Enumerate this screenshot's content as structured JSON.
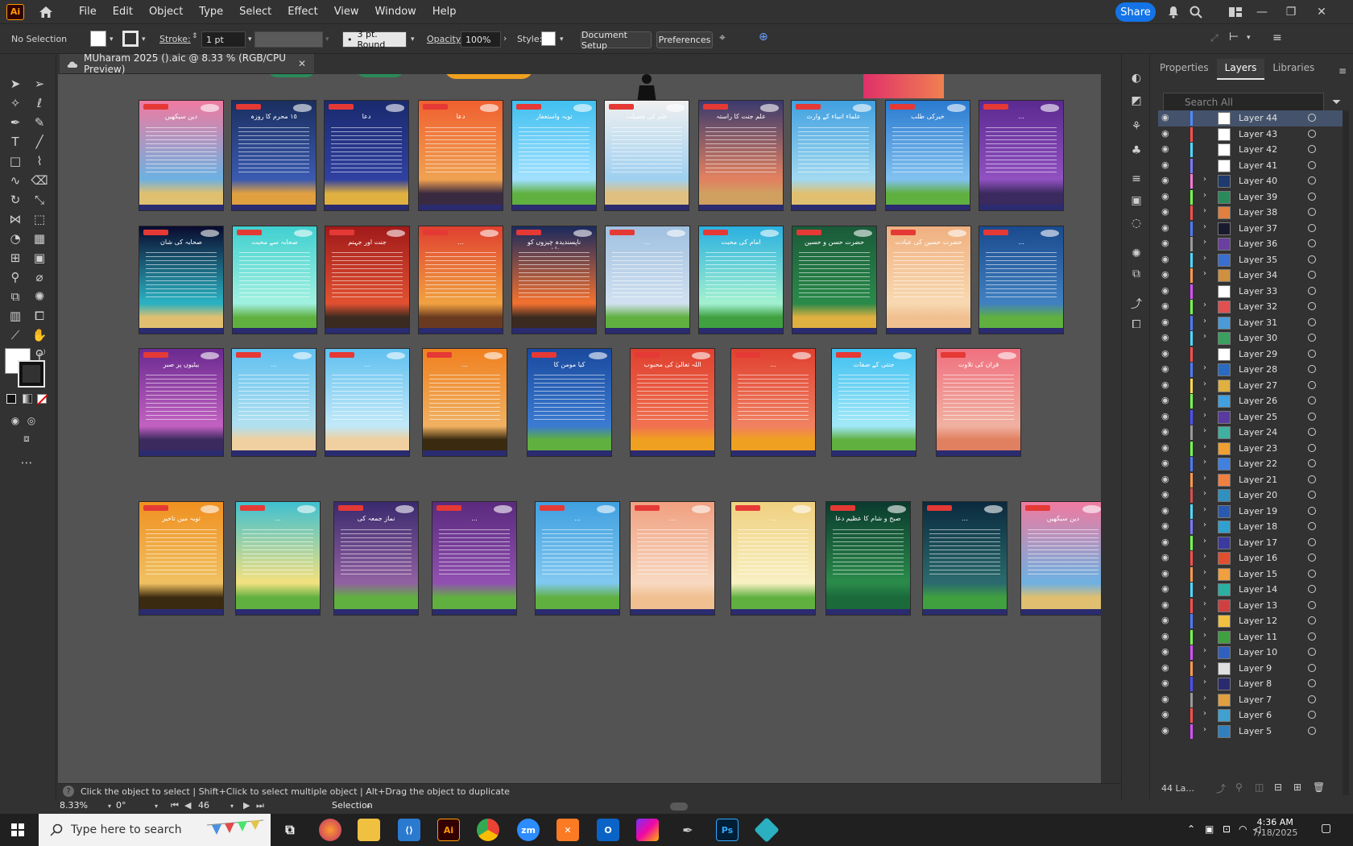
{
  "menubar": {
    "app_logo": "Ai",
    "items": [
      "File",
      "Edit",
      "Object",
      "Type",
      "Select",
      "Effect",
      "View",
      "Window",
      "Help"
    ],
    "share_label": "Share"
  },
  "controlbar": {
    "selection": "No Selection",
    "stroke_label": "Stroke:",
    "stroke_value": "1 pt",
    "brush_value": "3 pt. Round",
    "opacity_label": "Opacity:",
    "opacity_value": "100%",
    "style_label": "Style:",
    "document_setup": "Document Setup",
    "preferences": "Preferences"
  },
  "document": {
    "tab_title": "MUharam 2025 ().aic @ 8.33 % (RGB/CPU Preview)"
  },
  "panel": {
    "tabs": [
      "Properties",
      "Layers",
      "Libraries"
    ],
    "active_tab": "Layers",
    "search_placeholder": "Search All",
    "layers": [
      {
        "name": "Layer 44",
        "color": "#4f8bff",
        "thumb": "#ffffff"
      },
      {
        "name": "Layer 43",
        "color": "#ff4f4f",
        "thumb": "#ffffff"
      },
      {
        "name": "Layer 42",
        "color": "#4fd9ff",
        "thumb": "#ffffff"
      },
      {
        "name": "Layer 41",
        "color": "#7a7aff",
        "thumb": "#ffffff"
      },
      {
        "name": "Layer 40",
        "color": "#ff7ad9",
        "thumb": "#1e3a6e"
      },
      {
        "name": "Layer 39",
        "color": "#7aff4f",
        "thumb": "#2b8a5b"
      },
      {
        "name": "Layer 38",
        "color": "#ff4f4f",
        "thumb": "#e08040"
      },
      {
        "name": "Layer 37",
        "color": "#4f7aff",
        "thumb": "#1a1a2e"
      },
      {
        "name": "Layer 36",
        "color": "#9a9a9a",
        "thumb": "#6a3fa0"
      },
      {
        "name": "Layer 35",
        "color": "#4fd9ff",
        "thumb": "#3a6ecf"
      },
      {
        "name": "Layer 34",
        "color": "#ff9a4f",
        "thumb": "#d09040"
      },
      {
        "name": "Layer 33",
        "color": "#d94fff",
        "thumb": "#ffffff"
      },
      {
        "name": "Layer 32",
        "color": "#7aff4f",
        "thumb": "#e05050"
      },
      {
        "name": "Layer 31",
        "color": "#4f7aff",
        "thumb": "#4a9ad9"
      },
      {
        "name": "Layer 30",
        "color": "#4fd9ff",
        "thumb": "#3aa060"
      },
      {
        "name": "Layer 29",
        "color": "#ff4f4f",
        "thumb": "#ffffff"
      },
      {
        "name": "Layer 28",
        "color": "#4f7aff",
        "thumb": "#2a6ac0"
      },
      {
        "name": "Layer 27",
        "color": "#ffd94f",
        "thumb": "#e0b040"
      },
      {
        "name": "Layer 26",
        "color": "#7aff4f",
        "thumb": "#40a0e0"
      },
      {
        "name": "Layer 25",
        "color": "#4f4fff",
        "thumb": "#5a3aa0"
      },
      {
        "name": "Layer 24",
        "color": "#9a9a9a",
        "thumb": "#40b0a0"
      },
      {
        "name": "Layer 23",
        "color": "#7aff4f",
        "thumb": "#f0a030"
      },
      {
        "name": "Layer 22",
        "color": "#4f7aff",
        "thumb": "#4080e0"
      },
      {
        "name": "Layer 21",
        "color": "#ff9a4f",
        "thumb": "#f08040"
      },
      {
        "name": "Layer 20",
        "color": "#d94f4f",
        "thumb": "#3090c0"
      },
      {
        "name": "Layer 19",
        "color": "#4fd9ff",
        "thumb": "#2a5ab0"
      },
      {
        "name": "Layer 18",
        "color": "#7a7aff",
        "thumb": "#30a0d0"
      },
      {
        "name": "Layer 17",
        "color": "#7aff4f",
        "thumb": "#3a3aa0"
      },
      {
        "name": "Layer 16",
        "color": "#ff4f4f",
        "thumb": "#e05030"
      },
      {
        "name": "Layer 15",
        "color": "#ff9a4f",
        "thumb": "#f0a040"
      },
      {
        "name": "Layer 14",
        "color": "#4fd9ff",
        "thumb": "#2ab0a0"
      },
      {
        "name": "Layer 13",
        "color": "#ff4f4f",
        "thumb": "#d04040"
      },
      {
        "name": "Layer 12",
        "color": "#4f7aff",
        "thumb": "#f0c040"
      },
      {
        "name": "Layer 11",
        "color": "#7aff4f",
        "thumb": "#40a040"
      },
      {
        "name": "Layer 10",
        "color": "#d94fff",
        "thumb": "#3060c0"
      },
      {
        "name": "Layer 9",
        "color": "#ff9a4f",
        "thumb": "#e0e0e0"
      },
      {
        "name": "Layer 8",
        "color": "#4f4fff",
        "thumb": "#2a2a6e"
      },
      {
        "name": "Layer 7",
        "color": "#9a9a9a",
        "thumb": "#e0a040"
      },
      {
        "name": "Layer 6",
        "color": "#ff4f4f",
        "thumb": "#40a0d0"
      },
      {
        "name": "Layer 5",
        "color": "#d94fff",
        "thumb": "#3080c0"
      }
    ],
    "footer_count": "44 La..."
  },
  "status": {
    "hint": "Click the object to select  |  Shift+Click to select multiple object  |  Alt+Drag the object to duplicate",
    "zoom": "8.33%",
    "rotation": "0°",
    "artboard": "46",
    "mode": "Selection"
  },
  "taskbar": {
    "search_placeholder": "Type here to search",
    "time": "4:36 AM",
    "date": "7/18/2025"
  },
  "posters": [
    {
      "top": "#f07aa0",
      "mid": "#6fb0e0",
      "ground": "#e0c070",
      "title": "دین سیکھیں"
    },
    {
      "top": "#1a2e5e",
      "mid": "#3a5ab0",
      "ground": "#e0a040",
      "title": "١٥ محرم کا روزہ"
    },
    {
      "top": "#1a2a6e",
      "mid": "#3040a0",
      "ground": "#e0b040",
      "title": "دعا"
    },
    {
      "top": "#f06030",
      "mid": "#f0a050",
      "ground": "#3a2a40",
      "title": "دعا"
    },
    {
      "top": "#40c0f0",
      "mid": "#a0e0ff",
      "ground": "#60b040",
      "title": "توبہ واستغفار"
    },
    {
      "top": "#f0f0f0",
      "mid": "#a0d0f0",
      "ground": "#e0c080",
      "title": "علم کی فضیلت"
    },
    {
      "top": "#3a3a6e",
      "mid": "#e08060",
      "ground": "#d0a060",
      "title": "علم جنت کا راستہ"
    },
    {
      "top": "#40a0e0",
      "mid": "#a0d8f0",
      "ground": "#e0c070",
      "title": "علماء انبیاء کے وارث"
    },
    {
      "top": "#2a7ad0",
      "mid": "#80c0f0",
      "ground": "#60b040",
      "title": "خیرکی طلب"
    },
    {
      "top": "#5a2a90",
      "mid": "#9050c0",
      "ground": "#3a2a5e",
      "title": "..."
    },
    {
      "top": "#0a0a2e",
      "mid": "#2ab0c0",
      "ground": "#e0c070",
      "title": "صحابہ کی شان"
    },
    {
      "top": "#40d0d0",
      "mid": "#a0f0e0",
      "ground": "#60b040",
      "title": "صحابہ سے محبت"
    },
    {
      "top": "#a01a1a",
      "mid": "#e05030",
      "ground": "#3a2a20",
      "title": "جنت اور جہنم"
    },
    {
      "top": "#e04030",
      "mid": "#f0a040",
      "ground": "#6a3a20",
      "title": "..."
    },
    {
      "top": "#1a2a5e",
      "mid": "#f07030",
      "ground": "#3a2a20",
      "title": "ناپسندیدہ چیزوں کو برداشت"
    },
    {
      "top": "#a0c0e0",
      "mid": "#d0e0f0",
      "ground": "#60b040",
      "title": "..."
    },
    {
      "top": "#2ab0e0",
      "mid": "#a0f0d0",
      "ground": "#40a040",
      "title": "امام کی محبت"
    },
    {
      "top": "#1a5a3a",
      "mid": "#2a8a4a",
      "ground": "#e0b040",
      "title": "حضرت حسن و حسین"
    },
    {
      "top": "#f0b080",
      "mid": "#f8d8b0",
      "ground": "#f0c090",
      "title": "حضرت حسین کی عبادت"
    },
    {
      "top": "#1a4a8e",
      "mid": "#4080c0",
      "ground": "#60b040",
      "title": "..."
    },
    {
      "top": "#6a2a90",
      "mid": "#c060c0",
      "ground": "#3a2a5e",
      "title": "بیٹیوں پر صبر"
    },
    {
      "top": "#60c0f0",
      "mid": "#b0e0f0",
      "ground": "#f0d0a0",
      "title": "..."
    },
    {
      "top": "#60c0f0",
      "mid": "#c0e8f8",
      "ground": "#f0d0a0",
      "title": "..."
    },
    {
      "top": "#f08020",
      "mid": "#f0b060",
      "ground": "#3a2a10",
      "title": "..."
    },
    {
      "top": "#1a4a9e",
      "mid": "#3a7ad0",
      "ground": "#60b040",
      "title": "کیا مومن کا"
    },
    {
      "top": "#e04030",
      "mid": "#f07050",
      "ground": "#f0a020",
      "title": "اللہ تعالیٰ کی محبوب"
    },
    {
      "top": "#e04030",
      "mid": "#f08060",
      "ground": "#f0a020",
      "title": "..."
    },
    {
      "top": "#40c0f0",
      "mid": "#a0e8f8",
      "ground": "#60b040",
      "title": "جنتی کے صفات"
    },
    {
      "top": "#f07080",
      "mid": "#f0b0a0",
      "ground": "#e08060",
      "title": "قرآن کی تلاوت"
    },
    {
      "top": "#f09020",
      "mid": "#f0c060",
      "ground": "#3a2a10",
      "title": "توبہ میں تاخیر"
    },
    {
      "top": "#40c0d0",
      "mid": "#f0e080",
      "ground": "#60b040",
      "title": "..."
    },
    {
      "top": "#3a2a6e",
      "mid": "#9060a0",
      "ground": "#60b040",
      "title": "نماز جمعہ کی"
    },
    {
      "top": "#5a2a7e",
      "mid": "#9050b0",
      "ground": "#60b040",
      "title": "..."
    },
    {
      "top": "#40a0e0",
      "mid": "#80c8f0",
      "ground": "#60b040",
      "title": "..."
    },
    {
      "top": "#f0a080",
      "mid": "#f8d8c0",
      "ground": "#f0c090",
      "title": "..."
    },
    {
      "top": "#f0d080",
      "mid": "#f8f0c0",
      "ground": "#60b040",
      "title": "..."
    },
    {
      "top": "#0a3a2e",
      "mid": "#2a8a4a",
      "ground": "#1a6a3a",
      "title": "صبح و شام کا عظیم دعا"
    },
    {
      "top": "#0a2a3e",
      "mid": "#2a6a6e",
      "ground": "#40a040",
      "title": "..."
    }
  ]
}
